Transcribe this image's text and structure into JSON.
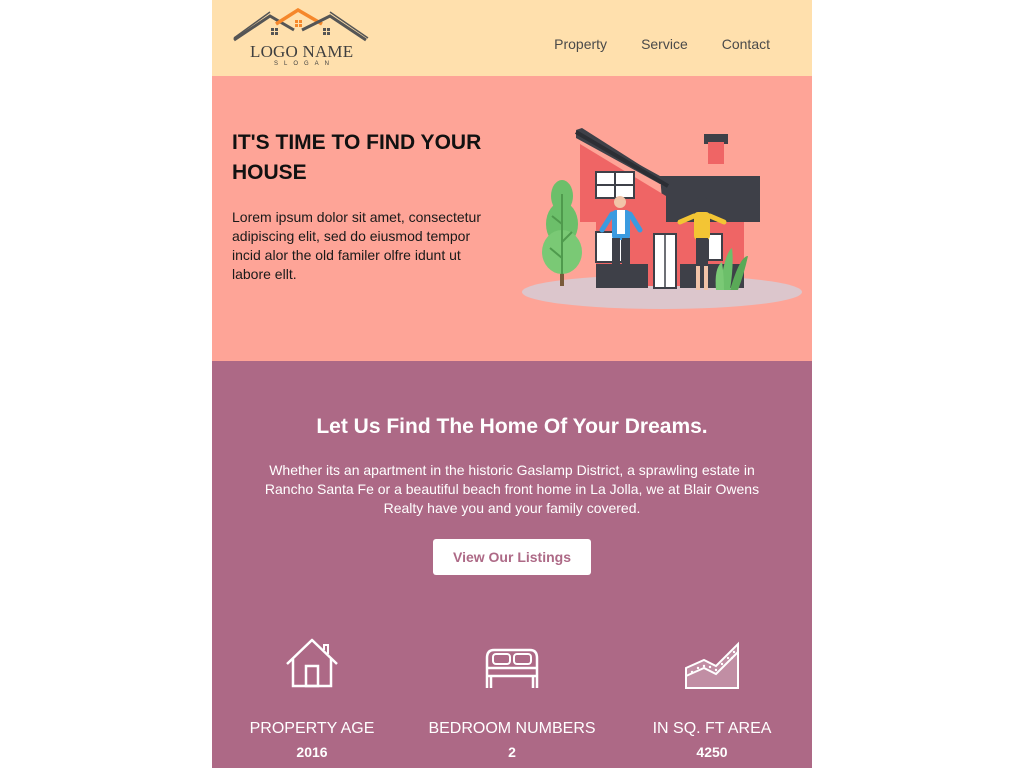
{
  "header": {
    "logo": {
      "name": "LOGO NAME",
      "slogan": "SLOGAN"
    },
    "nav": [
      {
        "label": "Property"
      },
      {
        "label": "Service"
      },
      {
        "label": "Contact"
      }
    ]
  },
  "hero": {
    "title": "IT'S TIME TO FIND YOUR HOUSE",
    "body": "Lorem ipsum dolor sit amet, consectetur adipiscing elit, sed do eiusmod tempor incid alor the old familer olfre idunt ut labore ellt."
  },
  "dreams": {
    "title": "Let Us Find The Home Of Your Dreams.",
    "body": "Whether its an apartment in the historic Gaslamp District, a sprawling estate in Rancho Santa Fe or a beautiful beach front home in La Jolla, we at Blair Owens Realty have you and your family covered.",
    "button_label": "View Our Listings"
  },
  "stats": [
    {
      "icon": "house-icon",
      "label": "PROPERTY AGE",
      "value": "2016"
    },
    {
      "icon": "bed-icon",
      "label": "BEDROOM NUMBERS",
      "value": "2"
    },
    {
      "icon": "area-chart-icon",
      "label": "IN SQ. FT AREA",
      "value": "4250"
    }
  ],
  "colors": {
    "header_bg": "#ffe0ad",
    "hero_bg": "#fea497",
    "dreams_bg": "#ad6986",
    "accent_orange": "#f5872b"
  }
}
